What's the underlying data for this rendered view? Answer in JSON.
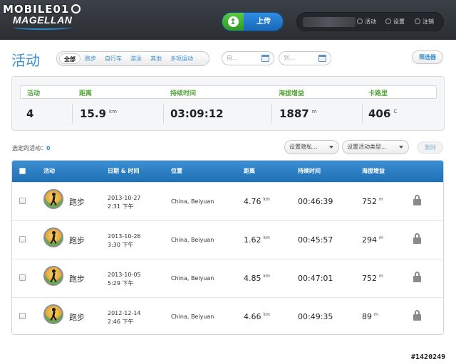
{
  "watermark": {
    "text": "MOBILE01"
  },
  "header": {
    "logo_text": "MAGELLAN",
    "upload_label": "上传",
    "user_links": {
      "activities": "活动",
      "settings": "设置",
      "logout": "注销"
    }
  },
  "page_title": "活动",
  "filters": [
    "全部",
    "跑步",
    "自行车",
    "游泳",
    "其他",
    "多项运动"
  ],
  "date_from_placeholder": "自...",
  "date_to_placeholder": "到...",
  "filter_button": "筛选器",
  "stats": {
    "labels": {
      "activities": "活动",
      "distance": "距离",
      "duration": "持续时间",
      "elevation": "海拔增益",
      "calories": "卡路里"
    },
    "values": {
      "activities": "4",
      "distance": "15.9",
      "distance_unit": "km",
      "duration": "03:09:12",
      "elevation": "1887",
      "elevation_unit": "m",
      "calories": "406",
      "calories_unit": "C"
    }
  },
  "selection": {
    "label": "选定的活动：",
    "count": "0",
    "privacy_dropdown": "设置隐私...",
    "type_dropdown": "设置活动类型...",
    "delete_label": "删除"
  },
  "table": {
    "headers": {
      "activity": "活动",
      "datetime": "日期 & 时间",
      "location": "位置",
      "distance": "距离",
      "duration": "持续时间",
      "elevation": "海拔增益"
    },
    "rows": [
      {
        "name": "跑步",
        "date": "2013-10-27",
        "time": "2:31 下午",
        "location": "China, Beiyuan",
        "distance": "4.76",
        "distance_unit": "km",
        "duration": "00:46:39",
        "elevation": "752",
        "elevation_unit": "m"
      },
      {
        "name": "跑步",
        "date": "2013-10-26",
        "time": "3:30 下午",
        "location": "China, Beiyuan",
        "distance": "1.62",
        "distance_unit": "km",
        "duration": "00:45:57",
        "elevation": "294",
        "elevation_unit": "m"
      },
      {
        "name": "跑步",
        "date": "2013-10-05",
        "time": "5:29 下午",
        "location": "China, Beiyuan",
        "distance": "4.85",
        "distance_unit": "km",
        "duration": "00:47:01",
        "elevation": "752",
        "elevation_unit": "m"
      },
      {
        "name": "跑步",
        "date": "2012-12-14",
        "time": "2:46 下午",
        "location": "China, Beiyuan",
        "distance": "4.66",
        "distance_unit": "km",
        "duration": "00:49:35",
        "elevation": "89",
        "elevation_unit": "m"
      }
    ]
  },
  "footer_id": "#1420249",
  "colors": {
    "accent_blue": "#3a8fd0",
    "stat_green": "#53a53a",
    "upload_green": "#3fb02f",
    "header_dark": "#33383d"
  }
}
